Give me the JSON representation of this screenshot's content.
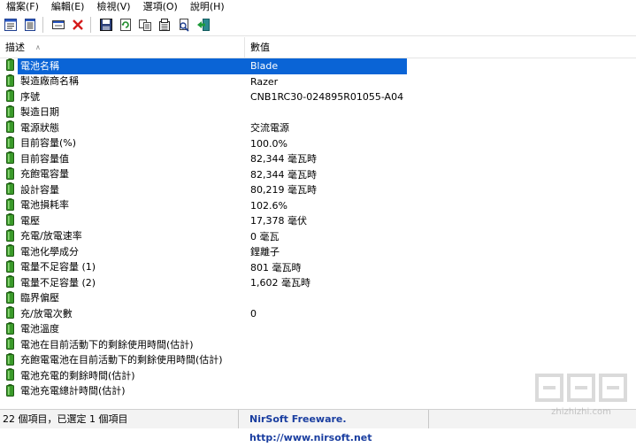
{
  "menu": [
    "檔案(F)",
    "編輯(E)",
    "檢視(V)",
    "選項(O)",
    "說明(H)"
  ],
  "columns": {
    "description": "描述",
    "value": "數值"
  },
  "rows": [
    {
      "label": "電池名稱",
      "value": "Blade"
    },
    {
      "label": "製造廠商名稱",
      "value": "Razer"
    },
    {
      "label": "序號",
      "value": "CNB1RC30-024895R01055-A04"
    },
    {
      "label": "製造日期",
      "value": ""
    },
    {
      "label": "電源狀態",
      "value": "交流電源"
    },
    {
      "label": "目前容量(%)",
      "value": "100.0%"
    },
    {
      "label": "目前容量值",
      "value": "82,344 毫瓦時"
    },
    {
      "label": "充飽電容量",
      "value": "82,344 毫瓦時"
    },
    {
      "label": "設計容量",
      "value": "80,219 毫瓦時"
    },
    {
      "label": "電池損耗率",
      "value": "102.6%"
    },
    {
      "label": "電壓",
      "value": "17,378 毫伏"
    },
    {
      "label": "充電/放電速率",
      "value": "0 毫瓦"
    },
    {
      "label": "電池化學成分",
      "value": "鋰離子"
    },
    {
      "label": "電量不足容量 (1)",
      "value": "801 毫瓦時"
    },
    {
      "label": "電量不足容量 (2)",
      "value": "1,602 毫瓦時"
    },
    {
      "label": "臨界偏壓",
      "value": ""
    },
    {
      "label": "充/放電次數",
      "value": "0"
    },
    {
      "label": "電池溫度",
      "value": ""
    },
    {
      "label": "電池在目前活動下的剩餘使用時間(估計)",
      "value": ""
    },
    {
      "label": "充飽電電池在目前活動下的剩餘使用時間(估計)",
      "value": ""
    },
    {
      "label": "電池充電的剩餘時間(估計)",
      "value": ""
    },
    {
      "label": "電池充電總計時間(估計)",
      "value": ""
    }
  ],
  "selected_index": 0,
  "status": {
    "items": "22 個項目，已選定 1 個項目",
    "credit": "NirSoft Freeware.  http://www.nirsoft.net"
  },
  "watermark": "zhizhizhi.com",
  "toolbar_icons": [
    "properties-icon",
    "html-report-icon",
    "options-icon",
    "delete-icon",
    "save-icon",
    "refresh-icon",
    "copy-icon",
    "copy-selected-icon",
    "find-icon",
    "exit-icon"
  ],
  "colors": {
    "selection": "#0a64d6",
    "battery_green": "#3a9a2a",
    "credit_blue": "#1a3ea0"
  }
}
